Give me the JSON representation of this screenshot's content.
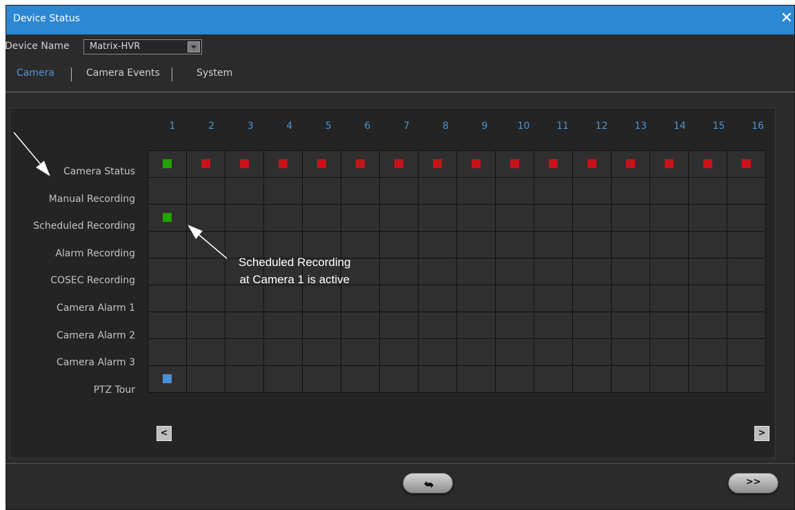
{
  "window": {
    "title": "Device Status",
    "close_glyph": "✕"
  },
  "device": {
    "label": "Device Name",
    "value": "Matrix-HVR"
  },
  "tabs": [
    {
      "label": "Camera",
      "active": true
    },
    {
      "label": "Camera Events",
      "active": false
    },
    {
      "label": "System",
      "active": false
    }
  ],
  "camera_grid": {
    "columns": [
      "1",
      "2",
      "3",
      "4",
      "5",
      "6",
      "7",
      "8",
      "9",
      "10",
      "11",
      "12",
      "13",
      "14",
      "15",
      "16"
    ],
    "rows": [
      {
        "label": "Camera Status",
        "cells": [
          "green",
          "red",
          "red",
          "red",
          "red",
          "red",
          "red",
          "red",
          "red",
          "red",
          "red",
          "red",
          "red",
          "red",
          "red",
          "red"
        ]
      },
      {
        "label": "Manual Recording",
        "cells": [
          "",
          "",
          "",
          "",
          "",
          "",
          "",
          "",
          "",
          "",
          "",
          "",
          "",
          "",
          "",
          ""
        ]
      },
      {
        "label": "Scheduled Recording",
        "cells": [
          "green",
          "",
          "",
          "",
          "",
          "",
          "",
          "",
          "",
          "",
          "",
          "",
          "",
          "",
          "",
          ""
        ]
      },
      {
        "label": "Alarm Recording",
        "cells": [
          "",
          "",
          "",
          "",
          "",
          "",
          "",
          "",
          "",
          "",
          "",
          "",
          "",
          "",
          "",
          ""
        ]
      },
      {
        "label": "COSEC Recording",
        "cells": [
          "",
          "",
          "",
          "",
          "",
          "",
          "",
          "",
          "",
          "",
          "",
          "",
          "",
          "",
          "",
          ""
        ]
      },
      {
        "label": "Camera Alarm 1",
        "cells": [
          "",
          "",
          "",
          "",
          "",
          "",
          "",
          "",
          "",
          "",
          "",
          "",
          "",
          "",
          "",
          ""
        ]
      },
      {
        "label": "Camera Alarm 2",
        "cells": [
          "",
          "",
          "",
          "",
          "",
          "",
          "",
          "",
          "",
          "",
          "",
          "",
          "",
          "",
          "",
          ""
        ]
      },
      {
        "label": "Camera Alarm 3",
        "cells": [
          "",
          "",
          "",
          "",
          "",
          "",
          "",
          "",
          "",
          "",
          "",
          "",
          "",
          "",
          "",
          ""
        ]
      },
      {
        "label": "PTZ Tour",
        "cells": [
          "blue",
          "",
          "",
          "",
          "",
          "",
          "",
          "",
          "",
          "",
          "",
          "",
          "",
          "",
          "",
          ""
        ]
      }
    ]
  },
  "status_colors": {
    "green": "#22a300",
    "red": "#c8121a",
    "blue": "#4b8fd4"
  },
  "nav": {
    "prev": "<",
    "next": ">"
  },
  "footer": {
    "refresh_icon": "refresh-icon",
    "next_label": ">>"
  },
  "annotation": {
    "line1": "Scheduled Recording",
    "line2": "at Camera 1 is active"
  }
}
